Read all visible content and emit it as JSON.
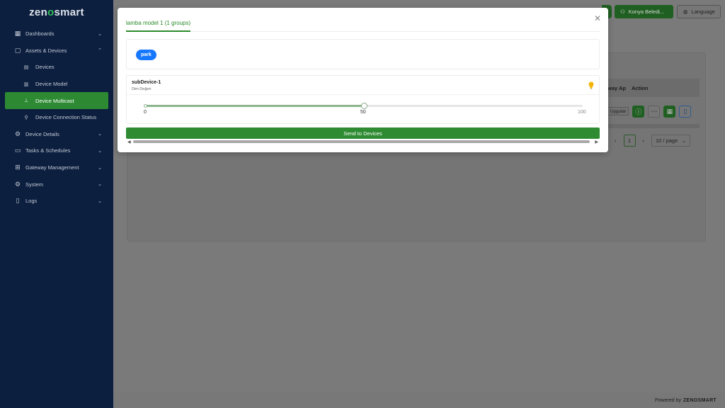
{
  "brand": {
    "logo_prefix": "zen",
    "logo_o": "o",
    "logo_suffix": "smart"
  },
  "sidebar": {
    "items": [
      {
        "label": "Dashboards",
        "icon": "dashboard-icon"
      },
      {
        "label": "Assets & Devices",
        "icon": "assets-icon",
        "expanded": true
      },
      {
        "label": "Devices",
        "icon": "devices-icon"
      },
      {
        "label": "Device Model",
        "icon": "device-model-icon"
      },
      {
        "label": "Device Multicast",
        "icon": "multicast-icon",
        "active": true
      },
      {
        "label": "Device Connection Status",
        "icon": "connection-icon"
      },
      {
        "label": "Device Details",
        "icon": "device-details-icon"
      },
      {
        "label": "Tasks & Schedules",
        "icon": "calendar-icon"
      },
      {
        "label": "Gateway Management",
        "icon": "gateway-icon"
      },
      {
        "label": "System",
        "icon": "gear-icon"
      },
      {
        "label": "Logs",
        "icon": "logs-icon"
      }
    ]
  },
  "header": {
    "user_label": "Konya Beledi...",
    "language_label": "Language"
  },
  "background": {
    "table_header_partial": "way Ap",
    "action_header": "Action",
    "row_tag": "Uygular",
    "page_number": "1",
    "page_size": "10 / page"
  },
  "modal": {
    "tab_label": "lamba model 1 (1 groups)",
    "group_tag": "park",
    "device": {
      "name": "subDevice-1",
      "attribute": "Dim Değeri",
      "slider_min": "0",
      "slider_value": "50",
      "slider_max": "100",
      "slider_fraction": 0.5
    },
    "send_button": "Send to Devices"
  },
  "footer": {
    "prefix": "Powered by",
    "brand": "ZENOSMART"
  },
  "colors": {
    "sidebar_bg": "#0c1f3f",
    "accent_green": "#2e8b32",
    "tag_blue": "#1677ff",
    "bulb_yellow": "#f5b50a"
  }
}
